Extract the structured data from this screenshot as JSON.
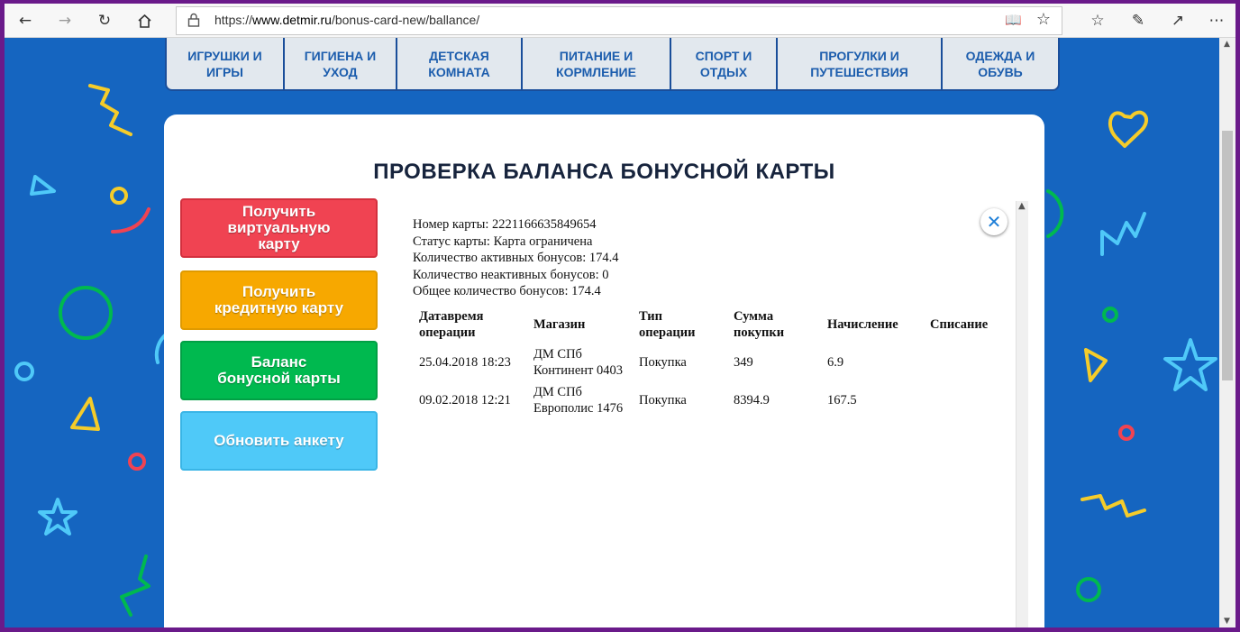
{
  "browser": {
    "url_prefix": "https://",
    "url_domain": "www.detmir.ru",
    "url_path": "/bonus-card-new/ballance/"
  },
  "categories": [
    {
      "label": "ИГРУШКИ И\nИГРЫ"
    },
    {
      "label": "ГИГИЕНА И\nУХОД"
    },
    {
      "label": "ДЕТСКАЯ\nКОМНАТА"
    },
    {
      "label": "ПИТАНИЕ И\nКОРМЛЕНИЕ"
    },
    {
      "label": "СПОРТ И\nОТДЫХ"
    },
    {
      "label": "ПРОГУЛКИ И\nПУТЕШЕСТВИЯ"
    },
    {
      "label": "ОДЕЖДА И\nОБУВЬ"
    }
  ],
  "page": {
    "title": "ПРОВЕРКА БАЛАНСА БОНУСНОЙ КАРТЫ"
  },
  "actions": {
    "virtual_card": "Получить\nвиртуальную\nкарту",
    "credit_card": "Получить\nкредитную карту",
    "bonus_balance": "Баланс\nбонусной карты",
    "update_form": "Обновить анкету",
    "colors": {
      "virtual_card": "#f04352",
      "credit_card": "#f7a800",
      "bonus_balance": "#00b94f",
      "update_form": "#4fc9f8"
    }
  },
  "card_info": {
    "number": "Номер карты: 2221166635849654",
    "status": "Статус карты: Карта ограничена",
    "active": "Количество активных бонусов: 174.4",
    "inactive": "Количество неактивных бонусов: 0",
    "total": "Общее количество бонусов: 174.4"
  },
  "operations": {
    "headers": [
      "Датавремя операции",
      "Магазин",
      "Тип операции",
      "Сумма покупки",
      "Начисление",
      "Списание"
    ],
    "rows": [
      [
        "25.04.2018 18:23",
        "ДМ СПб Континент 0403",
        "Покупка",
        "349",
        "6.9",
        ""
      ],
      [
        "09.02.2018 12:21",
        "ДМ СПб Европолис 1476",
        "Покупка",
        "8394.9",
        "167.5",
        ""
      ]
    ]
  },
  "close_symbol": "✕",
  "brand_color": "#1565c0"
}
